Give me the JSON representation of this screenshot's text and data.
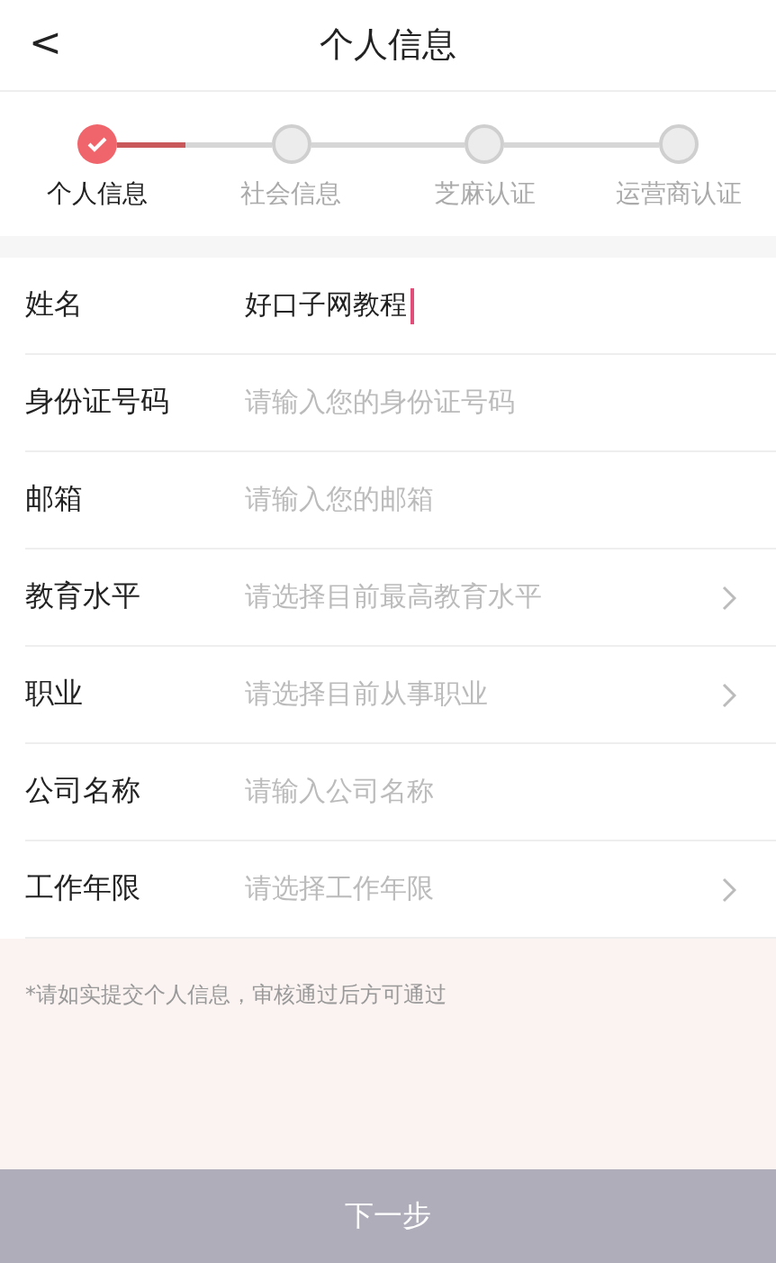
{
  "header": {
    "title": "个人信息",
    "back_icon": "<"
  },
  "steps": [
    {
      "label": "个人信息",
      "completed": true
    },
    {
      "label": "社会信息",
      "completed": false
    },
    {
      "label": "芝麻认证",
      "completed": false
    },
    {
      "label": "运营商认证",
      "completed": false
    }
  ],
  "fields": [
    {
      "kind": "input",
      "label": "姓名",
      "value": "好口子网教程",
      "focused": true
    },
    {
      "kind": "input",
      "label": "身份证号码",
      "placeholder": "请输入您的身份证号码",
      "focused": false
    },
    {
      "kind": "input",
      "label": "邮箱",
      "placeholder": "请输入您的邮箱",
      "focused": false
    },
    {
      "kind": "select",
      "label": "教育水平",
      "placeholder": "请选择目前最高教育水平",
      "focused": false
    },
    {
      "kind": "select",
      "label": "职业",
      "placeholder": "请选择目前从事职业",
      "focused": false
    },
    {
      "kind": "input",
      "label": "公司名称",
      "placeholder": "请输入公司名称",
      "focused": false
    },
    {
      "kind": "select",
      "label": "工作年限",
      "placeholder": "请选择工作年限",
      "focused": false
    }
  ],
  "notice": "*请如实提交个人信息，审核通过后方可通过",
  "next_button": {
    "label": "下一步",
    "disabled": true
  }
}
